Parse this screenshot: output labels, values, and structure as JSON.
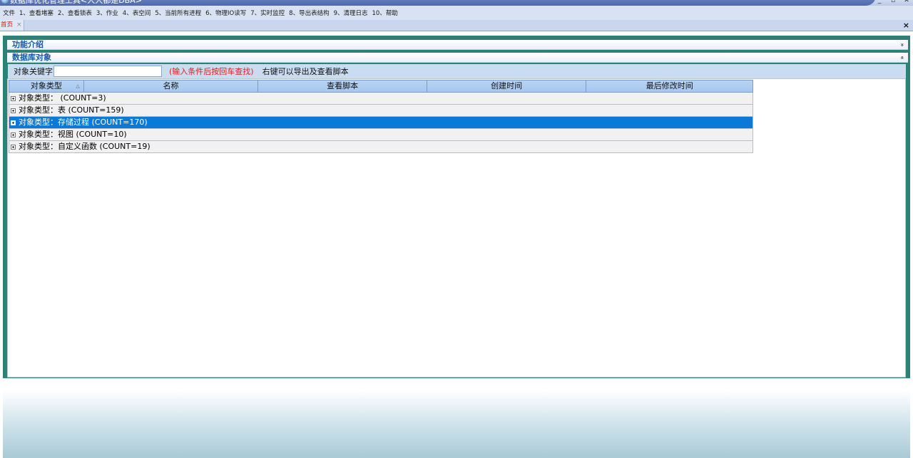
{
  "window": {
    "title": "数据库优化管理工具<人人都是DBA>",
    "controls": [
      "_",
      "▫",
      "✕"
    ]
  },
  "menu": [
    "文件",
    "1、查看堵塞",
    "2、查看锁表",
    "3、作业",
    "4、表空间",
    "5、当前所有进程",
    "6、物理IO读写",
    "7、实时监控",
    "8、导出表结构",
    "9、清理日志",
    "10、帮助"
  ],
  "tabs": {
    "home_label": "首页",
    "close_glyph": "×",
    "close_all_glyph": "×"
  },
  "panels": {
    "intro_title": "功能介绍",
    "intro_toggle": "»",
    "objects_title": "数据库对象",
    "objects_toggle": "«"
  },
  "search": {
    "label": "对象关键字",
    "value": "",
    "hint_red": "(输入条件后按回车查找)",
    "hint": "右键可以导出及查看脚本"
  },
  "grid": {
    "columns": [
      "对象类型",
      "名称",
      "查看脚本",
      "创建时间",
      "最后修改时间"
    ],
    "sort_glyph": "△",
    "groups": [
      {
        "label": "对象类型： (COUNT=3)",
        "selected": false
      },
      {
        "label": "对象类型：表 (COUNT=159)",
        "selected": false
      },
      {
        "label": "对象类型：存储过程 (COUNT=170)",
        "selected": true
      },
      {
        "label": "对象类型：视图 (COUNT=10)",
        "selected": false
      },
      {
        "label": "对象类型：自定义函数 (COUNT=19)",
        "selected": false
      }
    ]
  },
  "colors": {
    "frame": "#2b8276",
    "selected_row": "#0a79d7",
    "hint_red": "#e02020",
    "panel_title": "#1459a6"
  }
}
